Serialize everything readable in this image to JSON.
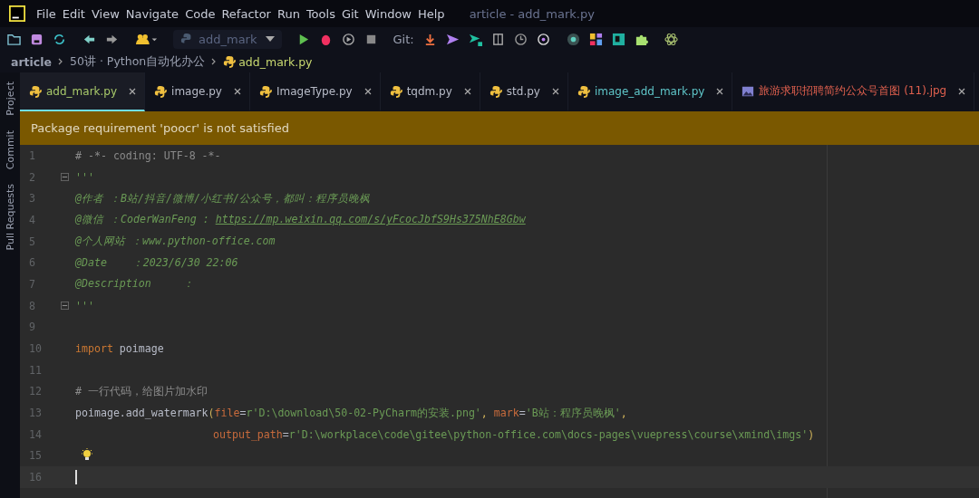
{
  "menu": [
    "File",
    "Edit",
    "View",
    "Navigate",
    "Code",
    "Refactor",
    "Run",
    "Tools",
    "Git",
    "Window",
    "Help"
  ],
  "window_title": "article - add_mark.py",
  "toolbar": {
    "run_config": "add_mark",
    "git_label": "Git:"
  },
  "breadcrumb": [
    "article",
    "50讲 · Python自动化办公",
    "add_mark.py"
  ],
  "side_tabs": [
    "Project",
    "Commit",
    "Pull Requests"
  ],
  "tabs": [
    {
      "label": "add_mark.py",
      "kind": "python",
      "color": "#a8c96a",
      "selected": true
    },
    {
      "label": "image.py",
      "kind": "python",
      "color": "#b8bcc8",
      "selected": false
    },
    {
      "label": "ImageType.py",
      "kind": "python",
      "color": "#b8bcc8",
      "selected": false
    },
    {
      "label": "tqdm.py",
      "kind": "python",
      "color": "#b8bcc8",
      "selected": false
    },
    {
      "label": "std.py",
      "kind": "python",
      "color": "#b8bcc8",
      "selected": false
    },
    {
      "label": "image_add_mark.py",
      "kind": "python",
      "color": "#5fc6c9",
      "selected": false
    },
    {
      "label": "旅游求职招聘简约公众号首图 (11).jpg",
      "kind": "image",
      "color": "#e0604e",
      "selected": false
    }
  ],
  "banner": "Package requirement 'poocr' is not satisfied",
  "lines": [
    {
      "number": "1",
      "fold": false,
      "bulb": false,
      "current": false,
      "tokens": [
        {
          "kind": "comment",
          "text": "# -*- coding: UTF-8 -*-"
        }
      ]
    },
    {
      "number": "2",
      "fold": true,
      "bulb": false,
      "current": false,
      "tokens": [
        {
          "kind": "doc",
          "text": "'''"
        }
      ]
    },
    {
      "number": "3",
      "fold": false,
      "bulb": false,
      "current": false,
      "tokens": [
        {
          "kind": "doc",
          "text": "@作者 ：B站/抖音/微博/小红书/公众号，都叫：程序员晚枫"
        }
      ]
    },
    {
      "number": "4",
      "fold": false,
      "bulb": false,
      "current": false,
      "tokens": [
        {
          "kind": "doc",
          "text": "@微信 ：CoderWanFeng : "
        },
        {
          "kind": "link",
          "text": "https://mp.weixin.qq.com/s/yFcocJbfS9Hs375NhE8Gbw"
        }
      ]
    },
    {
      "number": "5",
      "fold": false,
      "bulb": false,
      "current": false,
      "tokens": [
        {
          "kind": "doc",
          "text": "@个人网站 ：www.python-office.com"
        }
      ]
    },
    {
      "number": "6",
      "fold": false,
      "bulb": false,
      "current": false,
      "tokens": [
        {
          "kind": "doc",
          "text": "@Date    ：2023/6/30 22:06"
        }
      ]
    },
    {
      "number": "7",
      "fold": false,
      "bulb": false,
      "current": false,
      "tokens": [
        {
          "kind": "doc",
          "text": "@Description     ："
        }
      ]
    },
    {
      "number": "8",
      "fold": true,
      "bulb": false,
      "current": false,
      "tokens": [
        {
          "kind": "doc",
          "text": "'''"
        }
      ]
    },
    {
      "number": "9",
      "fold": false,
      "bulb": false,
      "current": false
    },
    {
      "number": "10",
      "fold": false,
      "bulb": false,
      "current": false,
      "tokens": [
        {
          "kind": "keyword",
          "text": "import"
        },
        {
          "kind": "plain",
          "text": " poimage"
        }
      ]
    },
    {
      "number": "11",
      "fold": false,
      "bulb": false,
      "current": false
    },
    {
      "number": "12",
      "fold": false,
      "bulb": false,
      "current": false,
      "tokens": [
        {
          "kind": "comment",
          "text": "# 一行代码，给图片加水印"
        }
      ]
    },
    {
      "number": "13",
      "fold": false,
      "bulb": false,
      "current": false,
      "tokens": [
        {
          "kind": "plain",
          "text": "poimage.add_watermark"
        },
        {
          "kind": "punct",
          "text": "("
        },
        {
          "kind": "param",
          "text": "file"
        },
        {
          "kind": "plain",
          "text": "="
        },
        {
          "kind": "string",
          "text": "r'D:\\download\\50-02-PyCharm的安装.png'"
        },
        {
          "kind": "punct",
          "text": ", "
        },
        {
          "kind": "param",
          "text": "mark"
        },
        {
          "kind": "plain",
          "text": "="
        },
        {
          "kind": "string",
          "text": "'B站：程序员晚枫'"
        },
        {
          "kind": "punct",
          "text": ","
        }
      ]
    },
    {
      "number": "14",
      "fold": false,
      "bulb": false,
      "current": false,
      "continuation": true,
      "tokens": [
        {
          "kind": "param",
          "text": "output_path"
        },
        {
          "kind": "plain",
          "text": "="
        },
        {
          "kind": "string",
          "text": "r'D:\\workplace\\code\\gitee\\python-office.com\\docs-pages\\vuepress\\course\\xmind\\imgs'"
        },
        {
          "kind": "punct",
          "text": ")"
        }
      ]
    },
    {
      "number": "15",
      "fold": false,
      "bulb": true,
      "current": false
    },
    {
      "number": "16",
      "fold": false,
      "bulb": false,
      "current": true
    }
  ]
}
